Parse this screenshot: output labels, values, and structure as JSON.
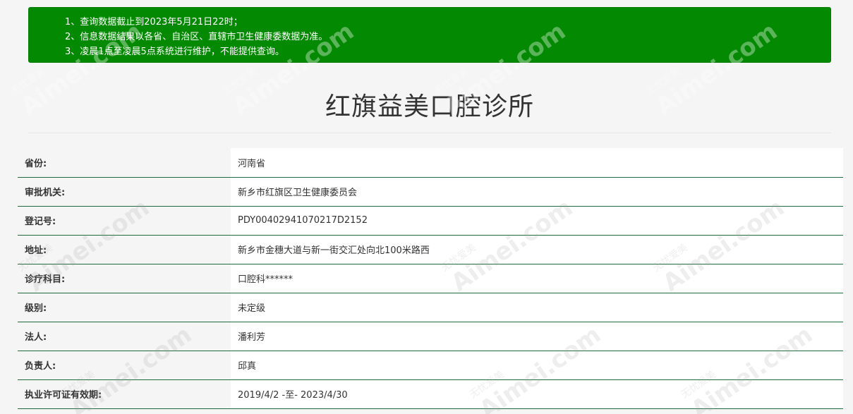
{
  "notice": {
    "items": [
      "1、查询数据截止到2023年5月21日22时；",
      "2、信息数据结果以各省、自治区、直辖市卫生健康委数据为准。",
      "3、凌晨1点至凌晨5点系统进行维护，不能提供查询。"
    ]
  },
  "page": {
    "title": "红旗益美口腔诊所"
  },
  "details": [
    {
      "label": "省份:",
      "value": "河南省"
    },
    {
      "label": "审批机关:",
      "value": "新乡市红旗区卫生健康委员会"
    },
    {
      "label": "登记号:",
      "value": "PDY00402941070217D2152"
    },
    {
      "label": "地址:",
      "value": "新乡市金穗大道与新一街交汇处向北100米路西"
    },
    {
      "label": "诊疗科目:",
      "value": "口腔科******"
    },
    {
      "label": "级别:",
      "value": "未定级"
    },
    {
      "label": "法人:",
      "value": "潘利芳"
    },
    {
      "label": "负责人:",
      "value": "邱真"
    },
    {
      "label": "执业许可证有效期:",
      "value": "2019/4/2 -至- 2023/4/30"
    }
  ],
  "watermark": {
    "text": "Aimei.com",
    "subtext": "无忧爱美"
  },
  "colors": {
    "notice_bg": "#048a02",
    "row_border": "#1e6a3c",
    "page_bg": "#f5f5f5"
  }
}
